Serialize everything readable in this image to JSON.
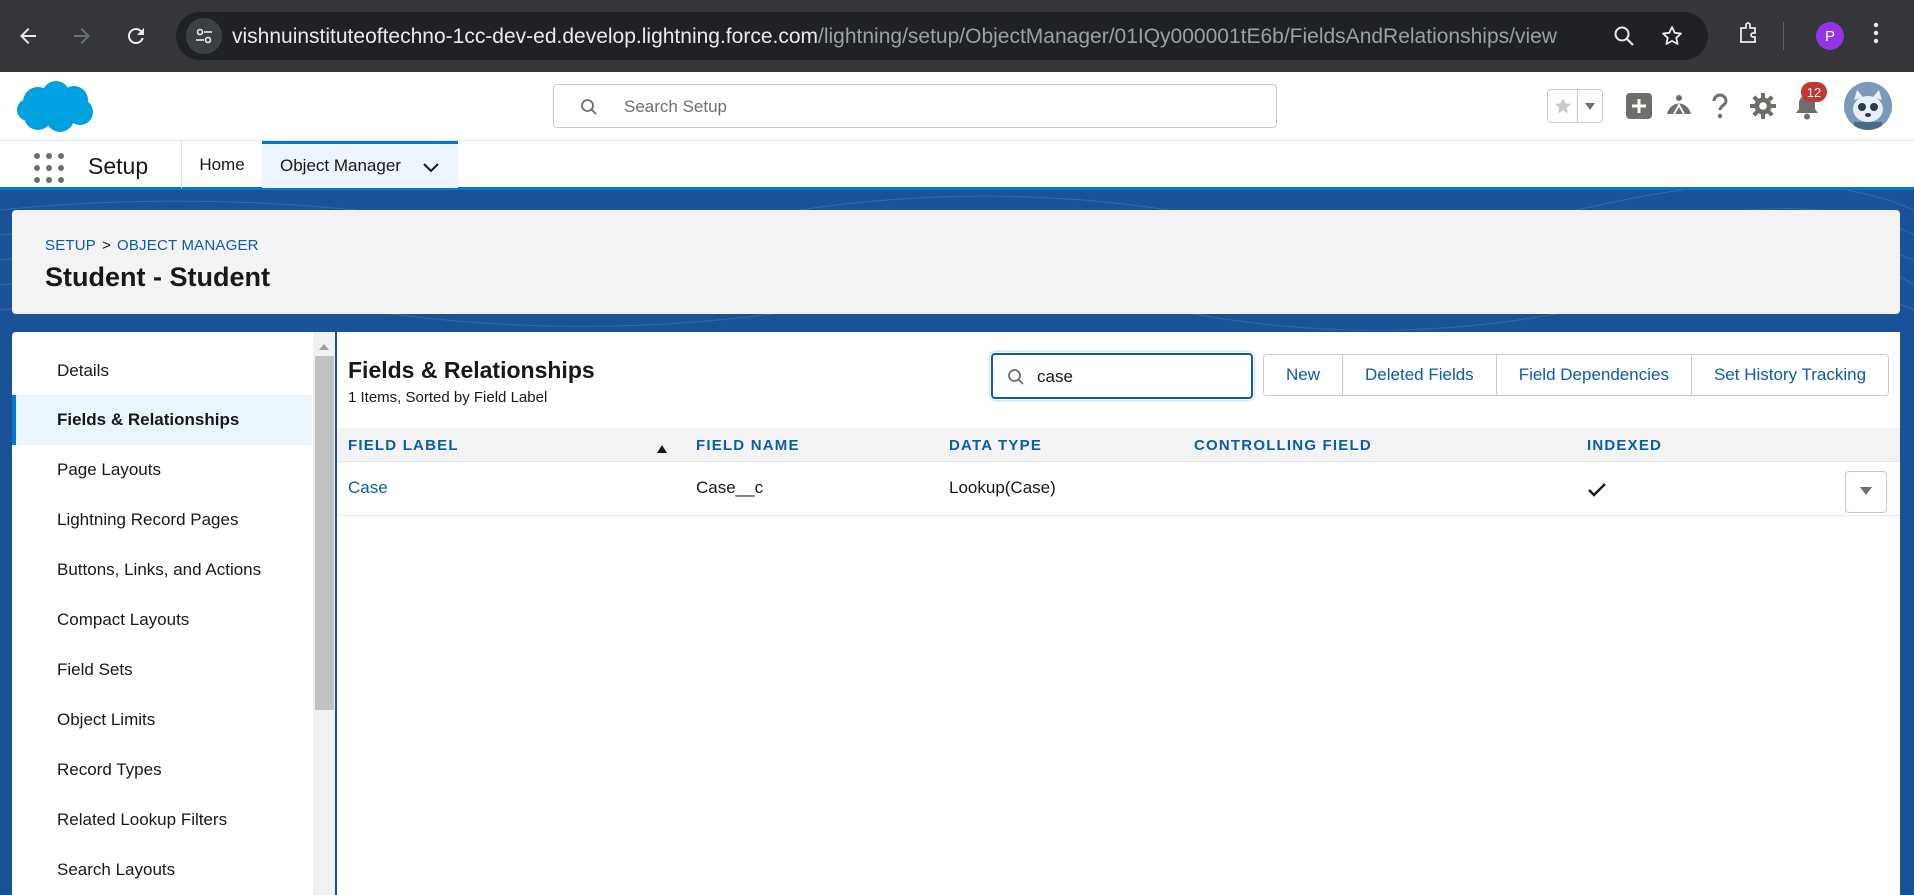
{
  "browser": {
    "url_host": "vishnuinstituteoftechno-1cc-dev-ed.develop.lightning.force.com",
    "url_path": "/lightning/setup/ObjectManager/01IQy000001tE6b/FieldsAndRelationships/view",
    "profile_initial": "P"
  },
  "header": {
    "search_placeholder": "Search Setup",
    "notification_count": "12"
  },
  "appnav": {
    "app_name": "Setup",
    "items": [
      {
        "label": "Home"
      },
      {
        "label": "Object Manager"
      }
    ]
  },
  "page": {
    "breadcrumb": {
      "setup": "SETUP",
      "separator": ">",
      "object_manager": "OBJECT MANAGER"
    },
    "title": "Student - Student"
  },
  "sidebar": {
    "items": [
      {
        "label": "Details"
      },
      {
        "label": "Fields & Relationships"
      },
      {
        "label": "Page Layouts"
      },
      {
        "label": "Lightning Record Pages"
      },
      {
        "label": "Buttons, Links, and Actions"
      },
      {
        "label": "Compact Layouts"
      },
      {
        "label": "Field Sets"
      },
      {
        "label": "Object Limits"
      },
      {
        "label": "Record Types"
      },
      {
        "label": "Related Lookup Filters"
      },
      {
        "label": "Search Layouts"
      }
    ]
  },
  "main": {
    "title": "Fields & Relationships",
    "subtitle": "1 Items, Sorted by Field Label",
    "filter_value": "case",
    "buttons": {
      "new": "New",
      "deleted_fields": "Deleted Fields",
      "field_dependencies": "Field Dependencies",
      "set_history_tracking": "Set History Tracking"
    },
    "columns": {
      "field_label": "FIELD LABEL",
      "field_name": "FIELD NAME",
      "data_type": "DATA TYPE",
      "controlling_field": "CONTROLLING FIELD",
      "indexed": "INDEXED"
    },
    "rows": [
      {
        "field_label": "Case",
        "field_name": "Case__c",
        "data_type": "Lookup(Case)",
        "controlling_field": "",
        "indexed": true
      }
    ]
  },
  "colors": {
    "brand_blue": "#0176d3",
    "link_blue": "#0b5cab",
    "background_blue": "#1b5297"
  }
}
